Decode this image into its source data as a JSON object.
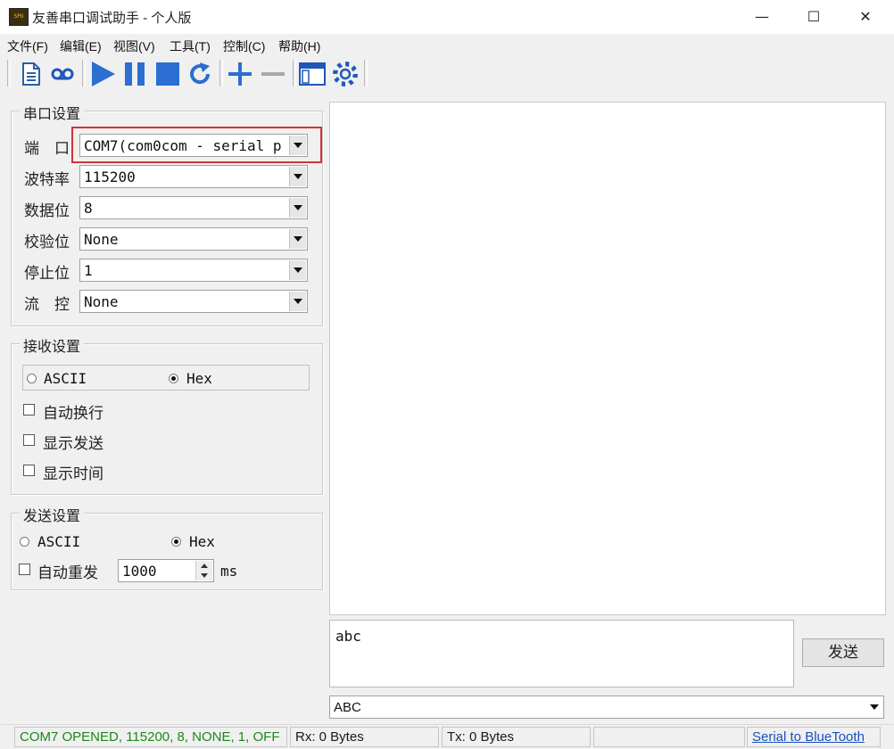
{
  "window": {
    "title": "友善串口调试助手 - 个人版",
    "app_icon_text": "SPU",
    "minimize_glyph": "—",
    "maximize_glyph": "☐",
    "close_glyph": "✕"
  },
  "menu": [
    "文件(F)",
    "编辑(E)",
    "视图(V)",
    "工具(T)",
    "控制(C)",
    "帮助(H)"
  ],
  "toolbar": {
    "icons": [
      "new-file-icon",
      "tape-icon",
      "play-icon",
      "pause-icon",
      "stop-icon",
      "refresh-icon",
      "add-icon",
      "remove-icon",
      "window-icon",
      "gear-icon"
    ],
    "accent_color": "#2a6fd1"
  },
  "serial_settings": {
    "title": "串口设置",
    "fields": [
      {
        "label": "端　口",
        "value": "COM7(com0com - serial p"
      },
      {
        "label": "波特率",
        "value": "115200"
      },
      {
        "label": "数据位",
        "value": "8"
      },
      {
        "label": "校验位",
        "value": "None"
      },
      {
        "label": "停止位",
        "value": "1"
      },
      {
        "label": "流　控",
        "value": "None"
      }
    ],
    "highlight_color": "#d0343a"
  },
  "receive_settings": {
    "title": "接收设置",
    "mode_ascii": "ASCII",
    "mode_hex": "Hex",
    "selected_mode": "Hex",
    "options": [
      {
        "label": "自动换行",
        "checked": false
      },
      {
        "label": "显示发送",
        "checked": false
      },
      {
        "label": "显示时间",
        "checked": false
      }
    ]
  },
  "send_settings": {
    "title": "发送设置",
    "mode_ascii": "ASCII",
    "mode_hex": "Hex",
    "selected_mode": "Hex",
    "auto_resend_label": "自动重发",
    "auto_resend_checked": false,
    "interval_value": "1000",
    "interval_unit": "ms"
  },
  "send_area": {
    "input_text": "abc",
    "send_button": "发送",
    "history_value": "ABC"
  },
  "status": {
    "port_status": "COM7 OPENED, 115200, 8, NONE, 1, OFF",
    "port_status_color": "#1a8a1a",
    "rx": "Rx: 0 Bytes",
    "tx": "Tx: 0 Bytes",
    "link": "Serial to BlueTooth",
    "link_color": "#1a4fc0"
  }
}
